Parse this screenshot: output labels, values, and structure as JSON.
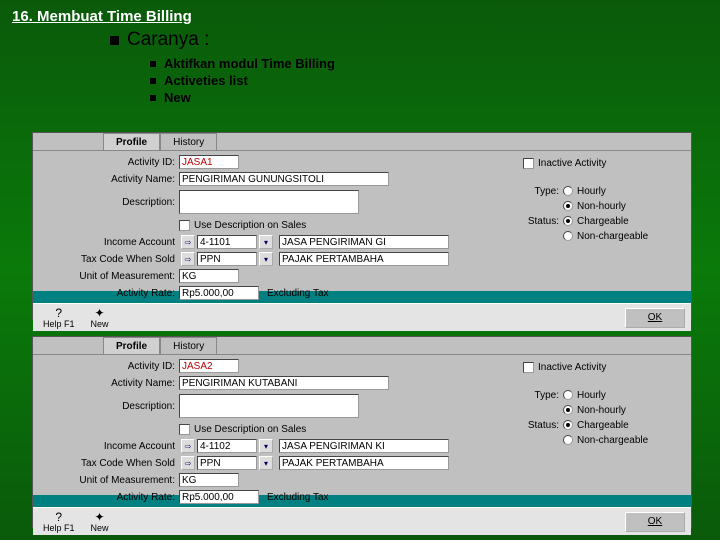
{
  "slide": {
    "title": "16. Membuat Time Billing",
    "caranya": "Caranya :",
    "steps": [
      "Aktifkan modul Time Billing",
      "Activeties list",
      "New"
    ]
  },
  "window1": {
    "tabs": {
      "profile": "Profile",
      "history": "History"
    },
    "labels": {
      "activity_id": "Activity ID:",
      "activity_name": "Activity Name:",
      "description": "Description:",
      "use_desc": "Use Description on Sales",
      "income_account": "Income Account",
      "tax_code": "Tax Code When Sold",
      "unit": "Unit of Measurement:",
      "rate": "Activity Rate:",
      "excluding": "Excluding Tax",
      "inactive": "Inactive Activity",
      "type": "Type:",
      "hourly": "Hourly",
      "nonhourly": "Non-hourly",
      "status": "Status:",
      "chargeable": "Chargeable",
      "nonchargeable": "Non-chargeable"
    },
    "values": {
      "activity_id": "JASA1",
      "activity_name": "PENGIRIMAN GUNUNGSITOLI",
      "income_account": "4-1101",
      "income_account_name": "JASA PENGIRIMAN GI",
      "tax_code": "PPN",
      "tax_name": "PAJAK PERTAMBAHA",
      "unit": "KG",
      "rate": "Rp5.000,00"
    },
    "buttons": {
      "help": "Help F1",
      "new": "New",
      "ok": "OK"
    },
    "selected_type": "nonhourly",
    "selected_status": "chargeable"
  },
  "window2": {
    "tabs": {
      "profile": "Profile",
      "history": "History"
    },
    "labels": {
      "activity_id": "Activity ID:",
      "activity_name": "Activity Name:",
      "description": "Description:",
      "use_desc": "Use Description on Sales",
      "income_account": "Income Account",
      "tax_code": "Tax Code When Sold",
      "unit": "Unit of Measurement:",
      "rate": "Activity Rate:",
      "excluding": "Excluding Tax",
      "inactive": "Inactive Activity",
      "type": "Type:",
      "hourly": "Hourly",
      "nonhourly": "Non-hourly",
      "status": "Status:",
      "chargeable": "Chargeable",
      "nonchargeable": "Non-chargeable"
    },
    "values": {
      "activity_id": "JASA2",
      "activity_name": "PENGIRIMAN KUTABANI",
      "income_account": "4-1102",
      "income_account_name": "JASA PENGIRIMAN KI",
      "tax_code": "PPN",
      "tax_name": "PAJAK PERTAMBAHA",
      "unit": "KG",
      "rate": "Rp5.000,00"
    },
    "buttons": {
      "help": "Help F1",
      "new": "New",
      "ok": "OK"
    },
    "selected_type": "nonhourly",
    "selected_status": "chargeable"
  }
}
